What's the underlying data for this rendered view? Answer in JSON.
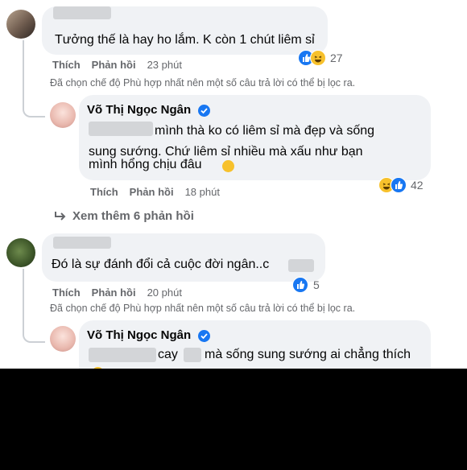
{
  "comments": [
    {
      "text": "Tưởng thế là hay ho lắm. K còn 1 chút liêm sỉ",
      "like_label": "Thích",
      "reply_label": "Phản hồi",
      "time": "23 phút",
      "reaction_count": "27",
      "notice": "Đã chọn chế độ Phù hợp nhất nên một số câu trả lời có thể bị lọc ra.",
      "reply": {
        "author": "Võ Thị Ngọc Ngân",
        "line1": "mình thà ko có liêm sỉ mà đẹp và sống",
        "line2": "sung sướng. Chứ liêm sỉ nhiều mà xấu như bạn",
        "line3": "mình hổng chịu đâu",
        "like_label": "Thích",
        "reply_label": "Phản hồi",
        "time": "18 phút",
        "reaction_count": "42"
      },
      "more_replies": "Xem thêm 6 phản hồi"
    },
    {
      "text": "Đó là sự đánh đổi cả cuộc đời ngân..c",
      "like_label": "Thích",
      "reply_label": "Phản hồi",
      "time": "20 phút",
      "reaction_count": "5",
      "notice": "Đã chọn chế độ Phù hợp nhất nên một số câu trả lời có thể bị lọc ra.",
      "reply": {
        "author": "Võ Thị Ngọc Ngân",
        "line1_a": "cay",
        "line1_b": "mà sống sung sướng ai chẳng thích"
      }
    }
  ],
  "colors": {
    "bubble": "#f0f2f5",
    "meta": "#65676b",
    "accent": "#1877f2",
    "haha": "#f7c12c"
  }
}
